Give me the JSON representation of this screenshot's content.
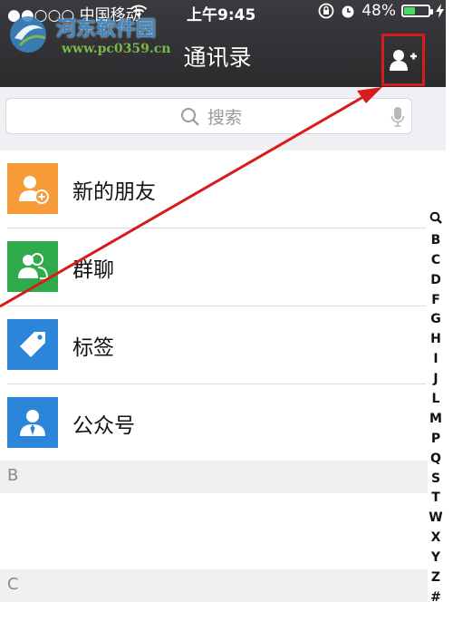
{
  "status_bar": {
    "carrier": "●●○○○ 中国移动",
    "time": "上午9:45",
    "battery_text": "48%",
    "battery_level": 0.48
  },
  "watermark": {
    "name": "河东软件园",
    "url": "www.pc0359.cn"
  },
  "nav": {
    "title": "通讯录",
    "add_contact_icon": "add-contact-icon"
  },
  "search": {
    "placeholder": "搜索"
  },
  "menu_items": [
    {
      "label": "新的朋友",
      "icon": "new-friend-icon",
      "color": "#f79a38"
    },
    {
      "label": "群聊",
      "icon": "group-chat-icon",
      "color": "#2fab4b"
    },
    {
      "label": "标签",
      "icon": "tag-icon",
      "color": "#2b86d9"
    },
    {
      "label": "公众号",
      "icon": "official-account-icon",
      "color": "#2b86d9"
    }
  ],
  "sections": [
    "B",
    "C"
  ],
  "alpha_index": [
    "🔍",
    "B",
    "C",
    "D",
    "F",
    "G",
    "H",
    "I",
    "J",
    "L",
    "M",
    "P",
    "Q",
    "S",
    "T",
    "W",
    "X",
    "Y",
    "Z",
    "#"
  ],
  "colors": {
    "header": "#2f2f32",
    "highlight": "#d81b1b"
  }
}
